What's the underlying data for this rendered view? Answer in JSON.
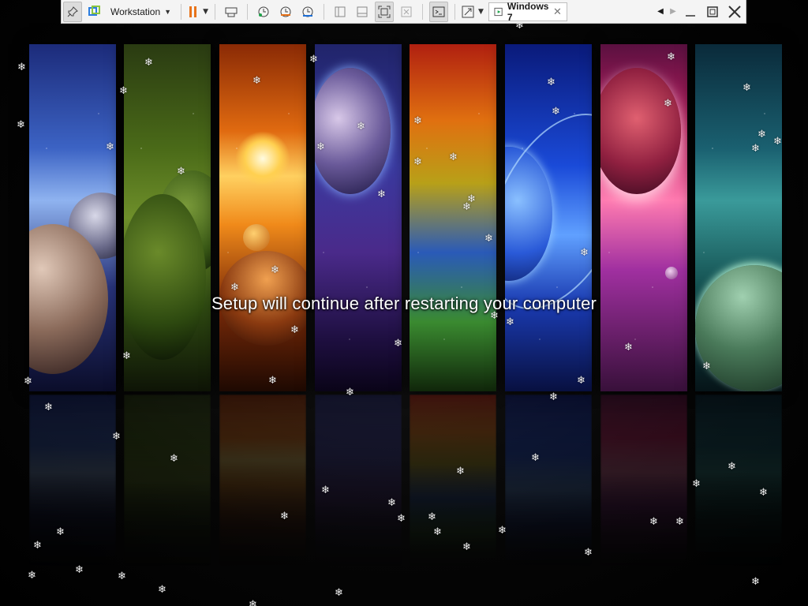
{
  "toolbar": {
    "menu_label": "Workstation",
    "vm_tab_label": "Windows 7",
    "vm_tab_close": "✕",
    "icons": [
      "pin-icon",
      "vmware-logo-icon",
      "pause-icon",
      "send-keys-icon",
      "snapshot-icon",
      "revert-snapshot-icon",
      "snapshot-manager-icon",
      "library-view-icon",
      "thumbnail-view-icon",
      "full-screen-icon",
      "unity-icon",
      "console-icon",
      "stretch-icon"
    ],
    "colors": {
      "pause": "#e8731a",
      "accent": "#1e6fd6"
    }
  },
  "screen": {
    "message": "Setup will continue after restarting your computer"
  },
  "snowflake_glyph": "❄"
}
